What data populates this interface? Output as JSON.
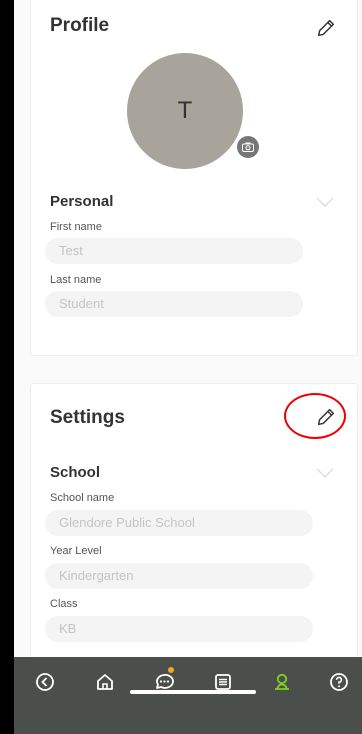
{
  "profile": {
    "title": "Profile",
    "avatar_initial": "T",
    "personal": {
      "title": "Personal",
      "first_name_label": "First name",
      "first_name_value": "Test",
      "last_name_label": "Last name",
      "last_name_value": "Student"
    }
  },
  "settings": {
    "title": "Settings",
    "school": {
      "title": "School",
      "school_name_label": "School name",
      "school_name_value": "Glendore Public School",
      "year_level_label": "Year Level",
      "year_level_value": "Kindergarten",
      "class_label": "Class",
      "class_value": "KB"
    }
  },
  "nav": {
    "items": [
      "back-icon",
      "home-icon",
      "chat-icon",
      "list-icon",
      "profile-icon",
      "help-icon"
    ],
    "active": "profile-icon",
    "active_color": "#7ed321",
    "notification_color": "#f5a623"
  },
  "colors": {
    "highlight": "#e00000",
    "navbar": "#4a4f4b",
    "avatar": "#a8a49b"
  }
}
